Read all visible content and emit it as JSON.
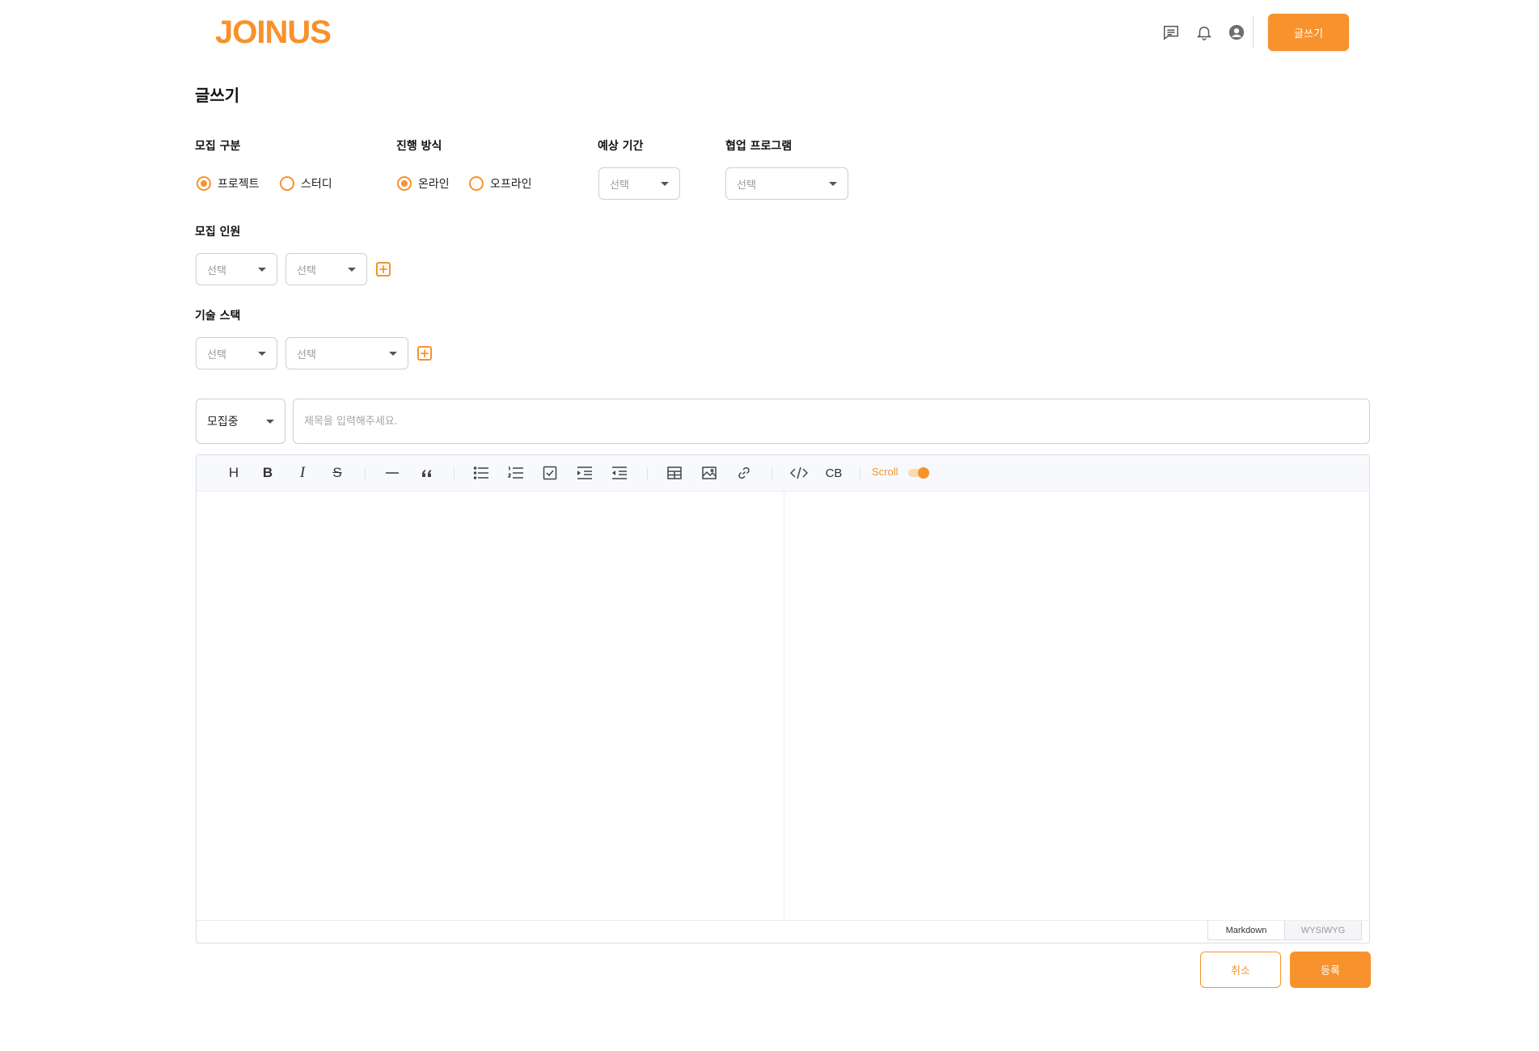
{
  "header": {
    "logo": "JOINUS",
    "write_button": "글쓰기"
  },
  "page_title": "글쓰기",
  "recruit_type": {
    "label": "모집 구분",
    "options": [
      "프로젝트",
      "스터디"
    ],
    "selected": "프로젝트"
  },
  "progress_method": {
    "label": "진행 방식",
    "options": [
      "온라인",
      "오프라인"
    ],
    "selected": "온라인"
  },
  "expected_period": {
    "label": "예상 기간",
    "placeholder": "선택"
  },
  "collab_program": {
    "label": "협업 프로그램",
    "placeholder": "선택"
  },
  "recruit_members": {
    "label": "모집 인원",
    "select1": "선택",
    "select2": "선택",
    "add_symbol": "+"
  },
  "tech_stack": {
    "label": "기술 스택",
    "select1": "선택",
    "select2": "선택",
    "add_symbol": "+"
  },
  "status_select": {
    "value": "모집중"
  },
  "title_input": {
    "placeholder": "제목을 입력해주세요.",
    "value": ""
  },
  "editor": {
    "toolbar": {
      "heading": "H",
      "bold": "B",
      "italic": "I",
      "strike": "S",
      "code_block": "CB",
      "scroll_label": "Scroll",
      "scroll_sync": true
    },
    "tabs": [
      "Markdown",
      "WYSIWYG"
    ],
    "active_tab": "Markdown"
  },
  "actions": {
    "cancel": "취소",
    "submit": "등록"
  },
  "colors": {
    "accent": "#f7922c"
  }
}
